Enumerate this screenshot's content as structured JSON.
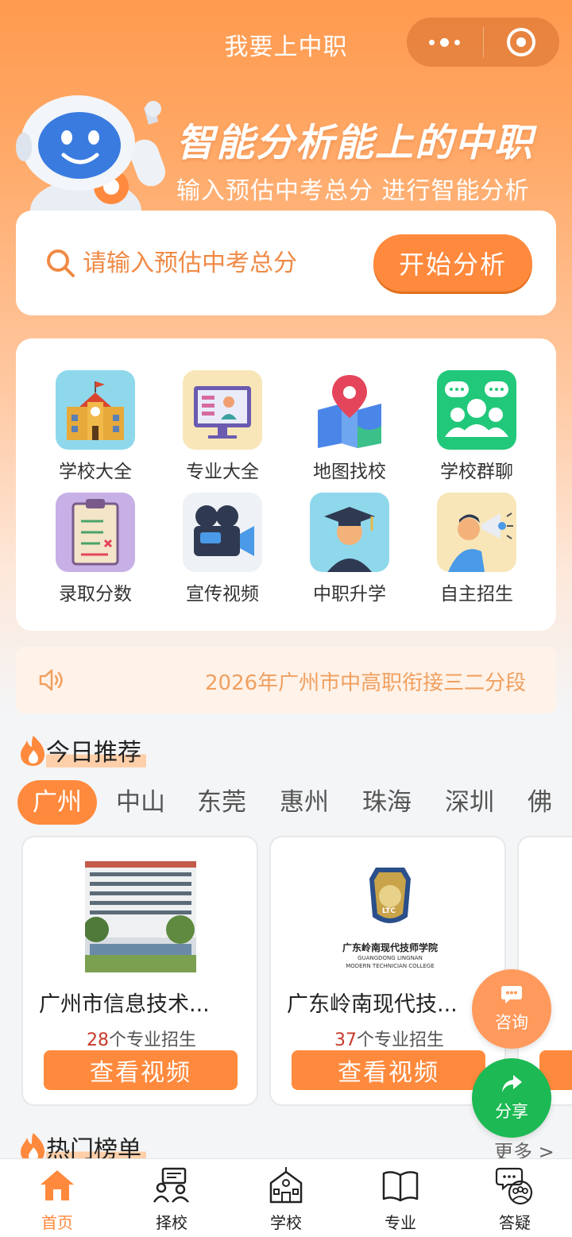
{
  "header": {
    "title": "我要上中职"
  },
  "hero": {
    "title": "智能分析能上的中职",
    "subtitle": "输入预估中考总分 进行智能分析"
  },
  "search": {
    "placeholder": "请输入预估中考总分",
    "button": "开始分析"
  },
  "grid": [
    {
      "label": "学校大全",
      "icon": "school-building-icon"
    },
    {
      "label": "专业大全",
      "icon": "monitor-presentation-icon"
    },
    {
      "label": "地图找校",
      "icon": "map-pin-icon"
    },
    {
      "label": "学校群聊",
      "icon": "group-chat-icon"
    },
    {
      "label": "录取分数",
      "icon": "clipboard-checklist-icon"
    },
    {
      "label": "宣传视频",
      "icon": "video-camera-icon"
    },
    {
      "label": "中职升学",
      "icon": "graduate-icon"
    },
    {
      "label": "自主招生",
      "icon": "megaphone-person-icon"
    }
  ],
  "notice": {
    "text": "2026年广州市中高职衔接三二分段"
  },
  "recommend": {
    "title": "今日推荐",
    "cities": [
      "广州",
      "中山",
      "东莞",
      "惠州",
      "珠海",
      "深圳",
      "佛"
    ],
    "schools": [
      {
        "name": "广州市信息技术...",
        "count": "28",
        "count_suffix": "个专业招生",
        "button": "查看视频",
        "logo_cn": "",
        "logo_en": ""
      },
      {
        "name": "广东岭南现代技...",
        "count": "37",
        "count_suffix": "个专业招生",
        "button": "查看视频",
        "logo_cn": "广东岭南现代技师学院",
        "logo_en1": "GUANGDONG LINGNAN",
        "logo_en2": "MODERN TECHNICIAN COLLEGE",
        "badge": "LTC"
      }
    ]
  },
  "hot": {
    "title": "热门榜单",
    "more": "更多 >"
  },
  "floating": {
    "consult": "咨询",
    "share": "分享"
  },
  "nav": [
    {
      "label": "首页",
      "icon": "home-icon"
    },
    {
      "label": "择校",
      "icon": "choose-school-icon"
    },
    {
      "label": "学校",
      "icon": "school-icon"
    },
    {
      "label": "专业",
      "icon": "book-icon"
    },
    {
      "label": "答疑",
      "icon": "qa-chat-icon"
    }
  ],
  "colors": {
    "primary": "#ff8a3d",
    "share": "#1db954",
    "count": "#c83a2a"
  }
}
